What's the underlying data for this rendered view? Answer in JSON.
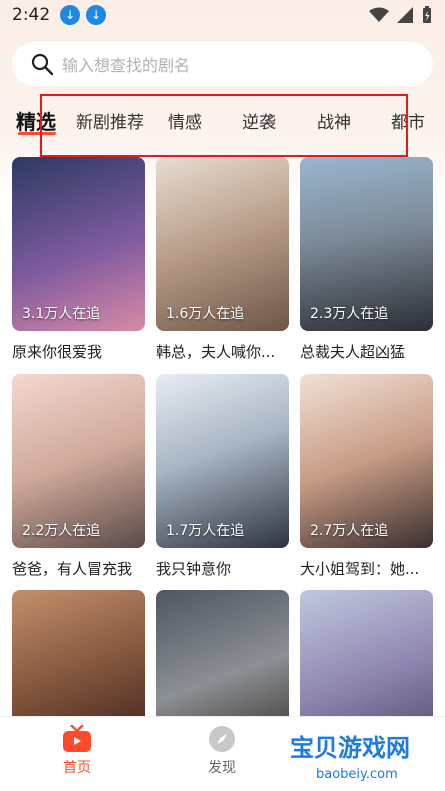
{
  "status_bar": {
    "time": "2:42"
  },
  "search": {
    "placeholder": "输入想查找的剧名"
  },
  "tabs": [
    {
      "label": "精选",
      "active": true
    },
    {
      "label": "新剧推荐"
    },
    {
      "label": "情感"
    },
    {
      "label": "逆袭"
    },
    {
      "label": "战神"
    },
    {
      "label": "都市"
    }
  ],
  "cards": [
    {
      "title": "原来你很爱我",
      "followers": "3.1万人在追"
    },
    {
      "title": "韩总，夫人喊你...",
      "followers": "1.6万人在追"
    },
    {
      "title": "总裁夫人超凶猛",
      "followers": "2.3万人在追"
    },
    {
      "title": "爸爸，有人冒充我",
      "followers": "2.2万人在追"
    },
    {
      "title": "我只钟意你",
      "followers": "1.7万人在追"
    },
    {
      "title": "大小姐驾到：她...",
      "followers": "2.7万人在追"
    },
    {
      "title": "",
      "followers": ""
    },
    {
      "title": "",
      "followers": ""
    },
    {
      "title": "",
      "followers": ""
    }
  ],
  "bottom_nav": [
    {
      "label": "首页",
      "icon": "home-tv-icon",
      "active": true,
      "color": "#ff4b2b"
    },
    {
      "label": "发现",
      "icon": "compass-icon"
    }
  ],
  "watermark": {
    "text": "宝贝游戏网",
    "url": "baobeiy.com"
  },
  "colors": {
    "accent": "#ff4b2b",
    "highlight_box": "#e21b1b"
  }
}
